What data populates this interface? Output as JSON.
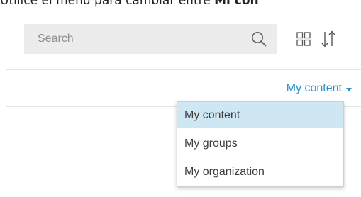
{
  "caption": {
    "prefix": "Utilice el menú para cambiar entre ",
    "bold": "Mi con"
  },
  "search": {
    "placeholder": "Search",
    "value": ""
  },
  "toolbar": {
    "grid_icon": "grid-view-icon",
    "sort_icon": "sort-icon"
  },
  "filter": {
    "selected_label": "My content",
    "accent_color": "#2e8dc6"
  },
  "dropdown": {
    "items": [
      {
        "label": "My content",
        "selected": true
      },
      {
        "label": "My groups",
        "selected": false
      },
      {
        "label": "My organization",
        "selected": false
      }
    ],
    "selected_bg": "#cfe6f3"
  }
}
